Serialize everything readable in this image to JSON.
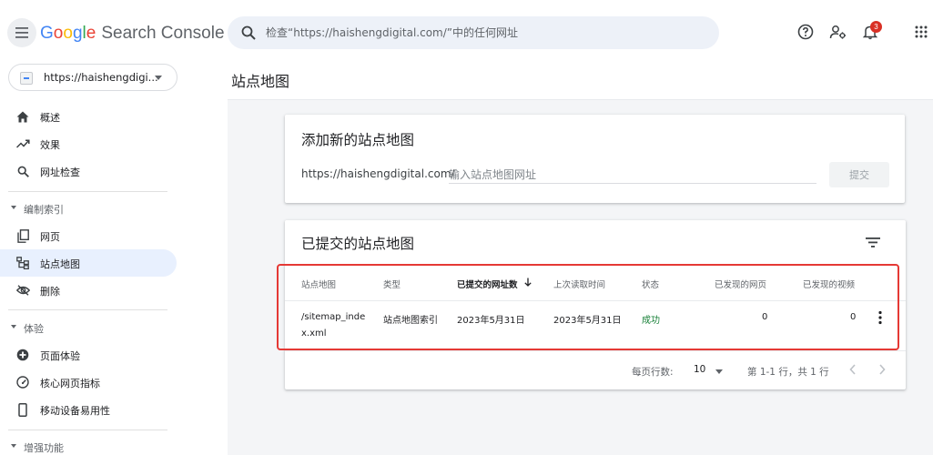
{
  "app": {
    "logo_letters": [
      "G",
      "o",
      "o",
      "g",
      "l",
      "e"
    ],
    "product": "Search Console"
  },
  "search": {
    "placeholder": "检查“https://haishengdigital.com/”中的任何网址"
  },
  "header_icons": [
    "help-icon",
    "manage-users-icon",
    "notifications-icon",
    "apps-grid-icon"
  ],
  "notifications": {
    "count": "3"
  },
  "property": {
    "label": "https://haishengdigi..."
  },
  "sidebar": {
    "items_top": [
      {
        "label": "概述",
        "icon": "home-icon"
      },
      {
        "label": "效果",
        "icon": "trending-icon"
      },
      {
        "label": "网址检查",
        "icon": "search-icon"
      }
    ],
    "section_index": {
      "label": "编制索引"
    },
    "items_index": [
      {
        "label": "网页",
        "icon": "pages-icon"
      },
      {
        "label": "站点地图",
        "icon": "sitemap-icon",
        "active": true
      },
      {
        "label": "删除",
        "icon": "removals-icon"
      }
    ],
    "section_experience": {
      "label": "体验"
    },
    "items_experience": [
      {
        "label": "页面体验",
        "icon": "page-experience-icon"
      },
      {
        "label": "核心网页指标",
        "icon": "core-web-vitals-icon"
      },
      {
        "label": "移动设备易用性",
        "icon": "mobile-icon"
      }
    ],
    "section_enhancements": {
      "label": "增强功能"
    }
  },
  "main": {
    "page_title": "站点地图",
    "add_card": {
      "title": "添加新的站点地图",
      "url_prefix": "https://haishengdigital.com/",
      "input_placeholder": "输入站点地图网址",
      "submit_label": "提交"
    },
    "submitted_card": {
      "title": "已提交的站点地图",
      "columns": [
        "站点地图",
        "类型",
        "已提交的网址数",
        "上次读取时间",
        "状态",
        "已发现的网页",
        "已发现的视频"
      ],
      "sorted_column": "已提交的网址数",
      "rows": [
        {
          "sitemap_line1": "/sitemap_inde",
          "sitemap_line2": "x.xml",
          "type": "站点地图索引",
          "submitted": "2023年5月31日",
          "last_read": "2023年5月31日",
          "status": "成功",
          "pages": "0",
          "videos": "0"
        }
      ],
      "pagination": {
        "rows_per_page_label": "每页行数:",
        "rows_per_page": "10",
        "range": "第 1-1 行，共 1 行"
      }
    }
  },
  "colors": {
    "accent": "#1a73e8",
    "active_bg": "#e8f0fe",
    "success": "#188038",
    "highlight": "#e53935",
    "badge": "#d93025"
  }
}
